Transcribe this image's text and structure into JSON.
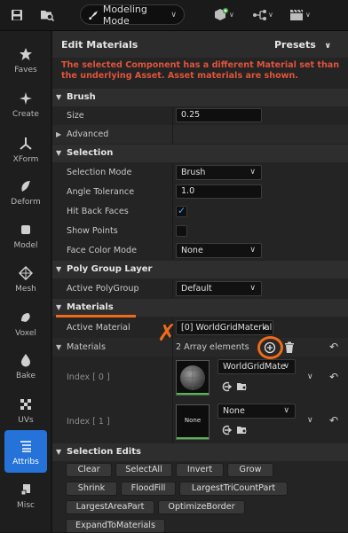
{
  "toolbar": {
    "mode_label": "Modeling Mode"
  },
  "sidebar": {
    "items": [
      {
        "label": "Faves"
      },
      {
        "label": "Create"
      },
      {
        "label": "XForm"
      },
      {
        "label": "Deform"
      },
      {
        "label": "Model"
      },
      {
        "label": "Mesh"
      },
      {
        "label": "Voxel"
      },
      {
        "label": "Bake"
      },
      {
        "label": "UVs"
      },
      {
        "label": "Attribs"
      },
      {
        "label": "Misc"
      }
    ]
  },
  "panel": {
    "title": "Edit Materials",
    "presets": "Presets",
    "warning": "The selected Component has a different Material set than the underlying Asset. Asset materials are shown."
  },
  "brush": {
    "section": "Brush",
    "size_label": "Size",
    "size_value": "0.25",
    "advanced": "Advanced"
  },
  "selection": {
    "section": "Selection",
    "mode_label": "Selection Mode",
    "mode_value": "Brush",
    "angle_label": "Angle Tolerance",
    "angle_value": "1.0",
    "hitback_label": "Hit Back Faces",
    "hitback_checked": true,
    "showpoints_label": "Show Points",
    "showpoints_checked": false,
    "facecolor_label": "Face Color Mode",
    "facecolor_value": "None"
  },
  "polygroup": {
    "section": "Poly Group Layer",
    "active_label": "Active PolyGroup",
    "active_value": "Default"
  },
  "materials": {
    "section": "Materials",
    "active_label": "Active Material",
    "active_value": "[0] WorldGridMaterial",
    "list_label": "Materials",
    "count": "2 Array elements",
    "index0_label": "Index [ 0 ]",
    "index0_value": "WorldGridMate",
    "index1_label": "Index [ 1 ]",
    "index1_value": "None",
    "index1_thumb": "None"
  },
  "selection_edits": {
    "section": "Selection Edits",
    "buttons": [
      "Clear",
      "SelectAll",
      "Invert",
      "Grow",
      "Shrink",
      "FloodFill",
      "LargestTriCountPart",
      "LargestAreaPart",
      "OptimizeBorder",
      "ExpandToMaterials"
    ]
  },
  "colors": {
    "accent": "#2573d9",
    "warning": "#e0543c",
    "annotation": "#f06a17",
    "check": "#4aa3ff"
  }
}
